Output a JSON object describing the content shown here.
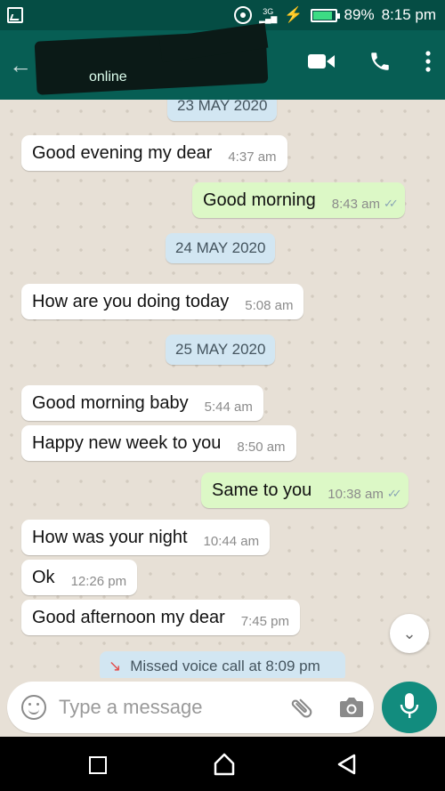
{
  "status_bar": {
    "network": "3G",
    "battery": "89%",
    "battery_level": 0.89,
    "time": "8:15 pm"
  },
  "header": {
    "contact_status": "online"
  },
  "messages": [
    {
      "type": "date",
      "text": "23 MAY 2020"
    },
    {
      "type": "in",
      "text": "Good evening my dear",
      "time": "4:37 am"
    },
    {
      "type": "out",
      "text": "Good morning",
      "time": "8:43 am",
      "read": true
    },
    {
      "type": "date",
      "text": "24 MAY 2020"
    },
    {
      "type": "in",
      "text": "How are you doing today",
      "time": "5:08 am"
    },
    {
      "type": "date",
      "text": "25 MAY 2020"
    },
    {
      "type": "in",
      "text": "Good morning baby",
      "time": "5:44 am"
    },
    {
      "type": "in",
      "text": "Happy new week to you",
      "time": "8:50 am"
    },
    {
      "type": "out",
      "text": "Same to you",
      "time": "10:38 am",
      "read": true
    },
    {
      "type": "in",
      "text": "How was your night",
      "time": "10:44 am"
    },
    {
      "type": "in",
      "text": "Ok",
      "time": "12:26 pm"
    },
    {
      "type": "in",
      "text": "Good afternoon my dear",
      "time": "7:45 pm"
    }
  ],
  "missed_call": "Missed voice call at 8:09 pm",
  "input": {
    "placeholder": "Type a message",
    "value": ""
  },
  "colors": {
    "header": "#075e54",
    "incoming": "#ffffff",
    "outgoing": "#dcf8c6",
    "date_chip": "#d2e6f2",
    "mic": "#128c7e"
  }
}
